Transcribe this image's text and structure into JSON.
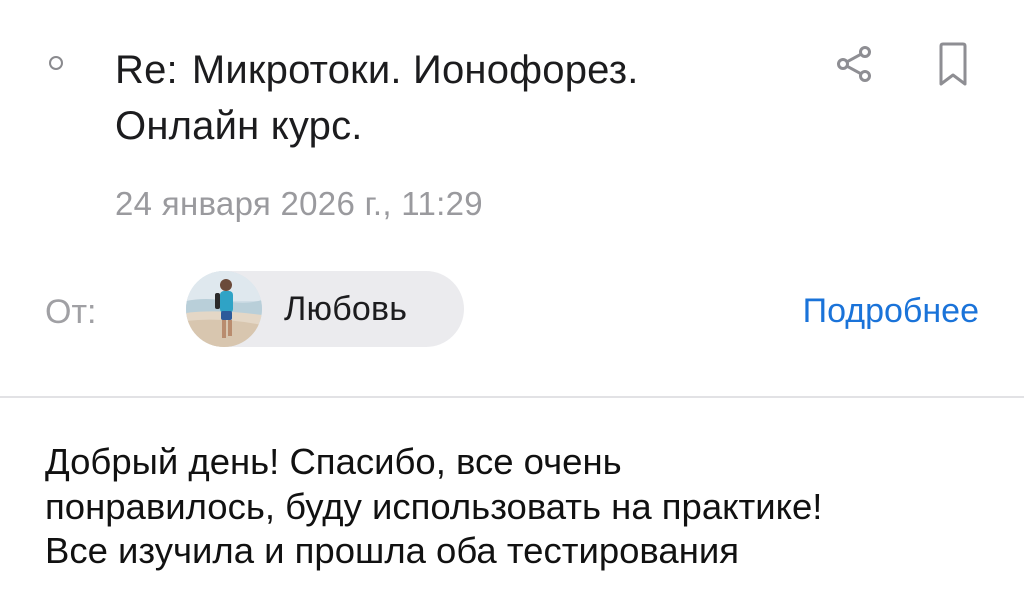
{
  "message": {
    "subject_prefix": "Re:",
    "subject": "Микротоки. Ионофорез. Онлайн курс.",
    "date": "24 января 2026 г., 11:29",
    "from_label": "От:",
    "sender_name": "Любовь",
    "details_link": "Подробнее",
    "body_lines": [
      "Добрый день! Спасибо, все очень",
      "понравилось, буду использовать на практике!",
      "Все изучила и прошла оба тестирования"
    ]
  },
  "icons": {
    "status": "unread-circle-icon",
    "share": "share-icon",
    "bookmark": "bookmark-icon"
  },
  "colors": {
    "accent": "#1a73d9",
    "secondary_text": "#9a9a9e",
    "chip_background": "#ebebee"
  }
}
